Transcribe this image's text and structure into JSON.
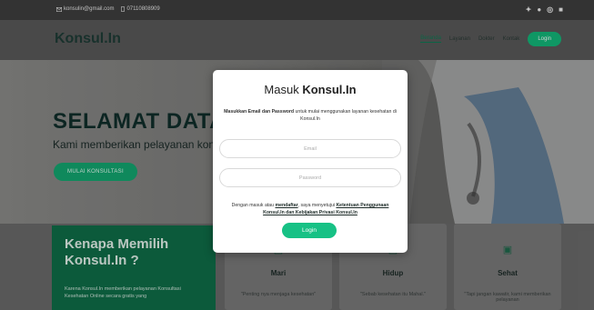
{
  "topbar": {
    "email": "konsulin@gmail.com",
    "phone": "07110808909"
  },
  "header": {
    "logo": "Konsul.In",
    "nav": [
      "Beranda",
      "Layanan",
      "Dokter",
      "Kontak"
    ],
    "login_label": "Login"
  },
  "hero": {
    "title": "SELAMAT DATANG",
    "subtitle": "Kami memberikan pelayanan konsultasi",
    "cta_label": "MULAI KONSULTASI"
  },
  "why": {
    "title": "Kenapa Memilih Konsul.In ?",
    "text": "Karena Konsul.In memberikan pelayanan Konsultasi Kesehatan Online secara gratis yang"
  },
  "cards": [
    {
      "title": "Mari",
      "text": "\"Penting nya menjaga kesehatan\""
    },
    {
      "title": "Hidup",
      "text": "\"Sebab kesehatan itu Mahal.\""
    },
    {
      "title": "Sehat",
      "text": "\"Tapi jangan kawatir, kami memberikan pelayanan"
    }
  ],
  "modal": {
    "title_prefix": "Masuk",
    "title_brand": "Konsul.In",
    "desc_bold": "Masukkan Email dan Password",
    "desc_rest": "untuk mulai menggunakan layanan kesehatan di Konsul.In",
    "email_placeholder": "Email",
    "password_placeholder": "Password",
    "terms_pre": "Dengan masuk atau",
    "terms_link1": "mendaftar",
    "terms_mid": ", saya menyetujui",
    "terms_link2": "Ketentuan Penggunaan Konsul.In dan Kebijakan Privasi Konsul.In",
    "login_label": "Login"
  },
  "colors": {
    "accent": "#13b97b",
    "dark_green": "#0f6e49"
  }
}
